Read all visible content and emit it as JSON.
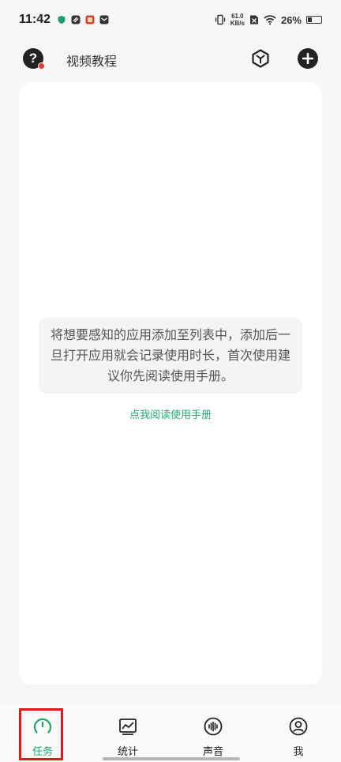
{
  "status_bar": {
    "time": "11:42",
    "net_speed_value": "61.0",
    "net_speed_unit": "KB/s",
    "battery_percent": "26%",
    "battery_level": 0.26
  },
  "header": {
    "tutorial_label": "视频教程",
    "icons": [
      "help-icon",
      "cube-icon",
      "add-icon"
    ]
  },
  "main": {
    "empty_message": "将想要感知的应用添加至列表中，添加后一旦打开应用就会记录使用时长，首次使用建议你先阅读使用手册。",
    "manual_link": "点我阅读使用手册"
  },
  "bottom_nav": {
    "items": [
      {
        "label": "任务",
        "icon": "gauge-icon",
        "active": true
      },
      {
        "label": "统计",
        "icon": "chart-icon",
        "active": false
      },
      {
        "label": "声音",
        "icon": "sound-wave-icon",
        "active": false
      },
      {
        "label": "我",
        "icon": "profile-icon",
        "active": false
      }
    ]
  },
  "colors": {
    "accent": "#22a86b",
    "highlight": "#e0191b",
    "background": "#f5f6f8"
  }
}
